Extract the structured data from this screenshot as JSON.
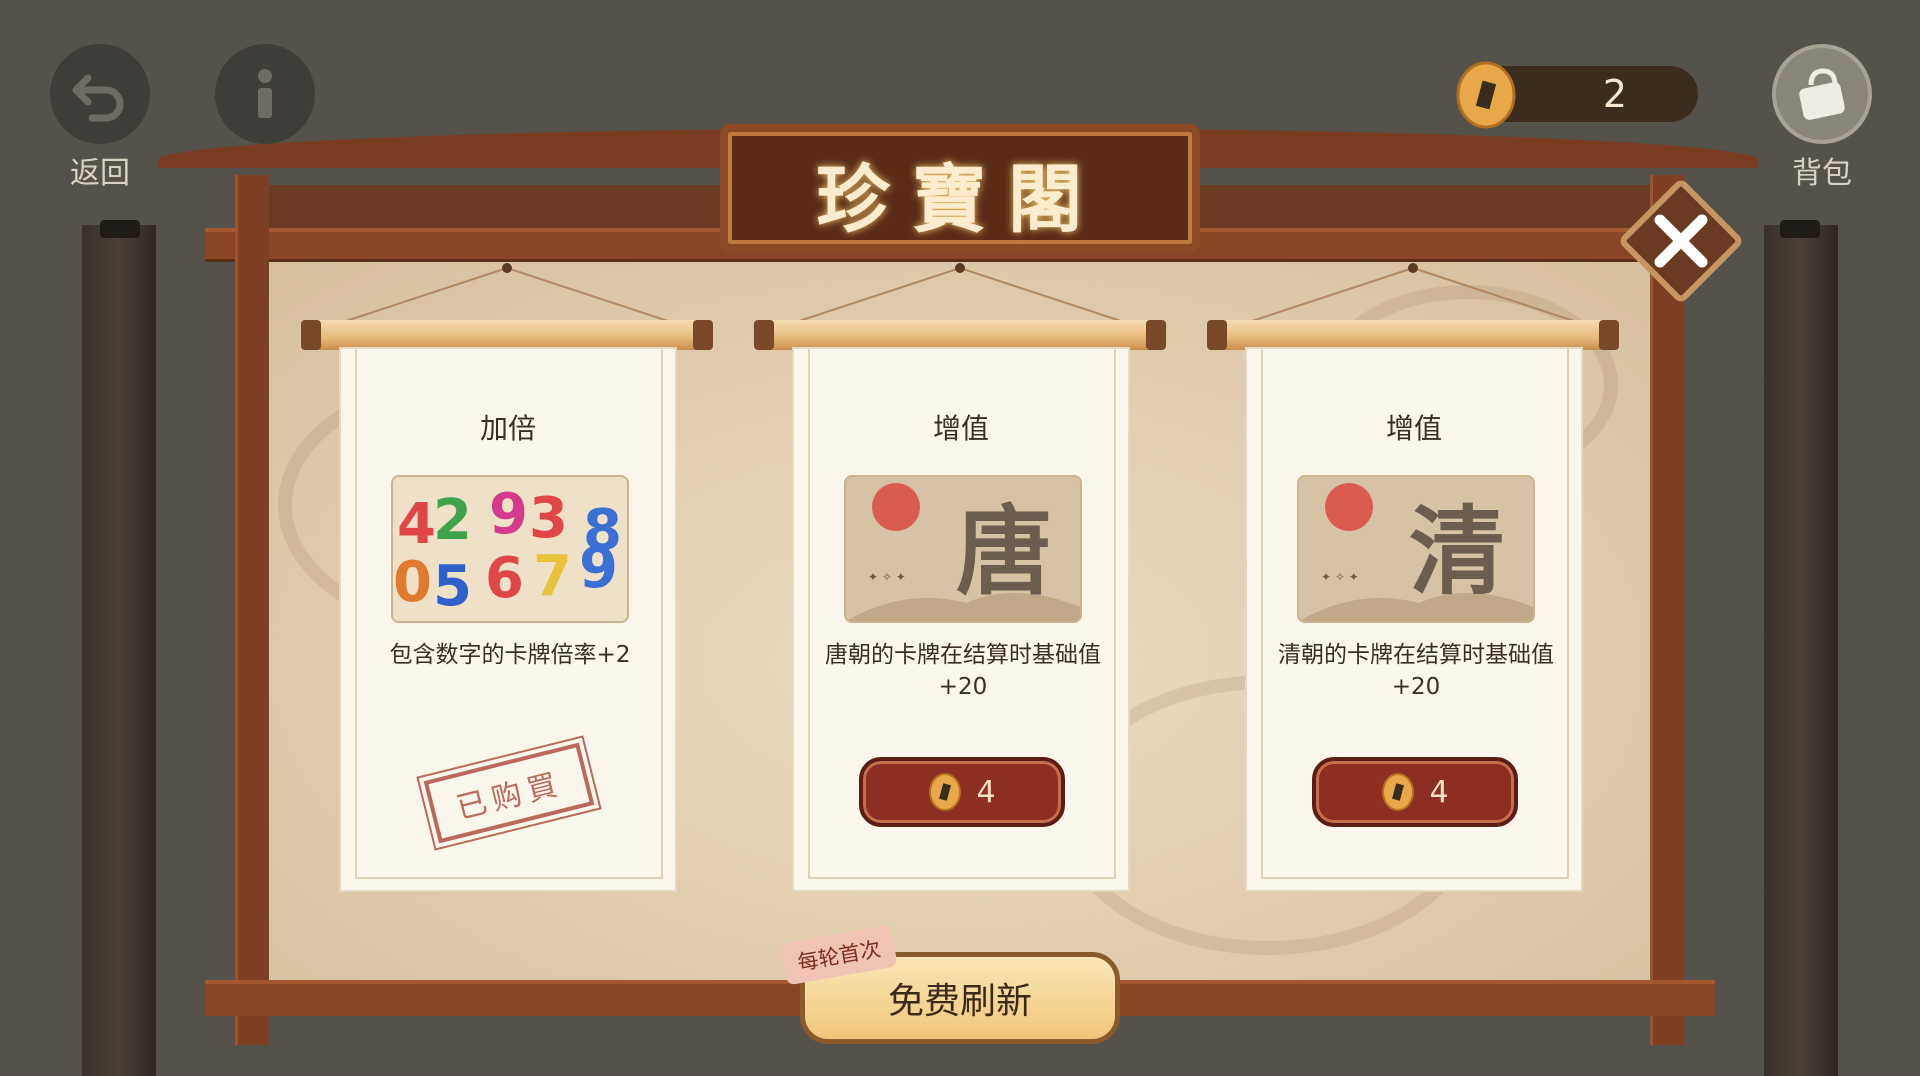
{
  "top_bar": {
    "back_label": "返回",
    "bag_label": "背包",
    "coin_count": "2"
  },
  "shop": {
    "title": "珍寶閣",
    "cards": [
      {
        "title": "加倍",
        "image": "colorful-numbers",
        "description": "包含数字的卡牌倍率+2",
        "state": "purchased",
        "stamp": "已购買"
      },
      {
        "title": "增值",
        "image": "tang-character",
        "image_char": "唐",
        "description": "唐朝的卡牌在结算时基础值+20",
        "state": "available",
        "price": "4"
      },
      {
        "title": "增值",
        "image": "qing-character",
        "image_char": "清",
        "description": "清朝的卡牌在结算时基础值+20",
        "state": "available",
        "price": "4"
      }
    ],
    "refresh_tag": "每轮首次",
    "refresh_label": "免费刷新"
  },
  "colors": {
    "frame_wood": "#8a4526",
    "price_button": "#8c2e20",
    "refresh_button": "#efc67a",
    "background": "#54524a"
  }
}
